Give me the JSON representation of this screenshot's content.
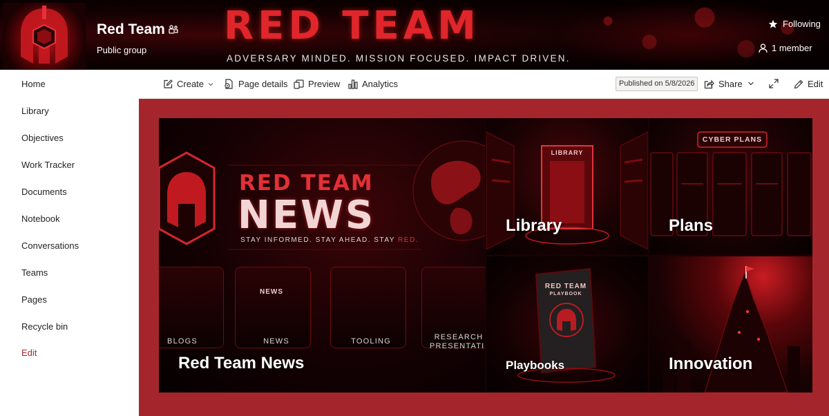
{
  "site": {
    "title": "Red Team",
    "subtitle": "Public group",
    "following_label": "Following",
    "members_label": "1 member"
  },
  "banner": {
    "title": "RED TEAM",
    "tagline": "ADVERSARY MINDED. MISSION FOCUSED. IMPACT DRIVEN."
  },
  "nav": {
    "items": [
      "Home",
      "Library",
      "Objectives",
      "Work Tracker",
      "Documents",
      "Notebook",
      "Conversations",
      "Teams",
      "Pages",
      "Recycle bin",
      "Edit"
    ]
  },
  "cmdbar": {
    "create_label": "Create",
    "page_details_label": "Page details",
    "preview_label": "Preview",
    "analytics_label": "Analytics",
    "published_label": "Published on 5/8/2026",
    "share_label": "Share",
    "edit_label": "Edit"
  },
  "tiles": {
    "news": {
      "label": "Red Team News",
      "headline_1": "RED TEAM",
      "headline_2": "NEWS",
      "tagline_1": "STAY INFORMED. STAY AHEAD. STAY ",
      "tagline_2": "RED.",
      "cards": [
        "BLOGS",
        "NEWS",
        "TOOLING",
        "RESEARCH PRESENTATION"
      ],
      "card_sign": "NEWS"
    },
    "library": {
      "label": "Library",
      "caption": "LIBRARY"
    },
    "plans": {
      "label": "Plans",
      "caption": "CYBER PLANS"
    },
    "playbooks": {
      "label": "Playbooks",
      "caption_1": "RED TEAM",
      "caption_2": "PLAYBOOK"
    },
    "innovation": {
      "label": "Innovation"
    }
  },
  "colors": {
    "accent": "#a4262c",
    "banner_red": "#e0262b"
  },
  "icons": {
    "following": "star-icon",
    "members": "person-icon",
    "site": "teams-icon",
    "create": "edit-square-icon",
    "page_details": "settings-doc-icon",
    "preview": "preview-icon",
    "analytics": "analytics-icon",
    "share": "share-icon",
    "expand": "expand-icon",
    "edit": "pencil-icon"
  }
}
